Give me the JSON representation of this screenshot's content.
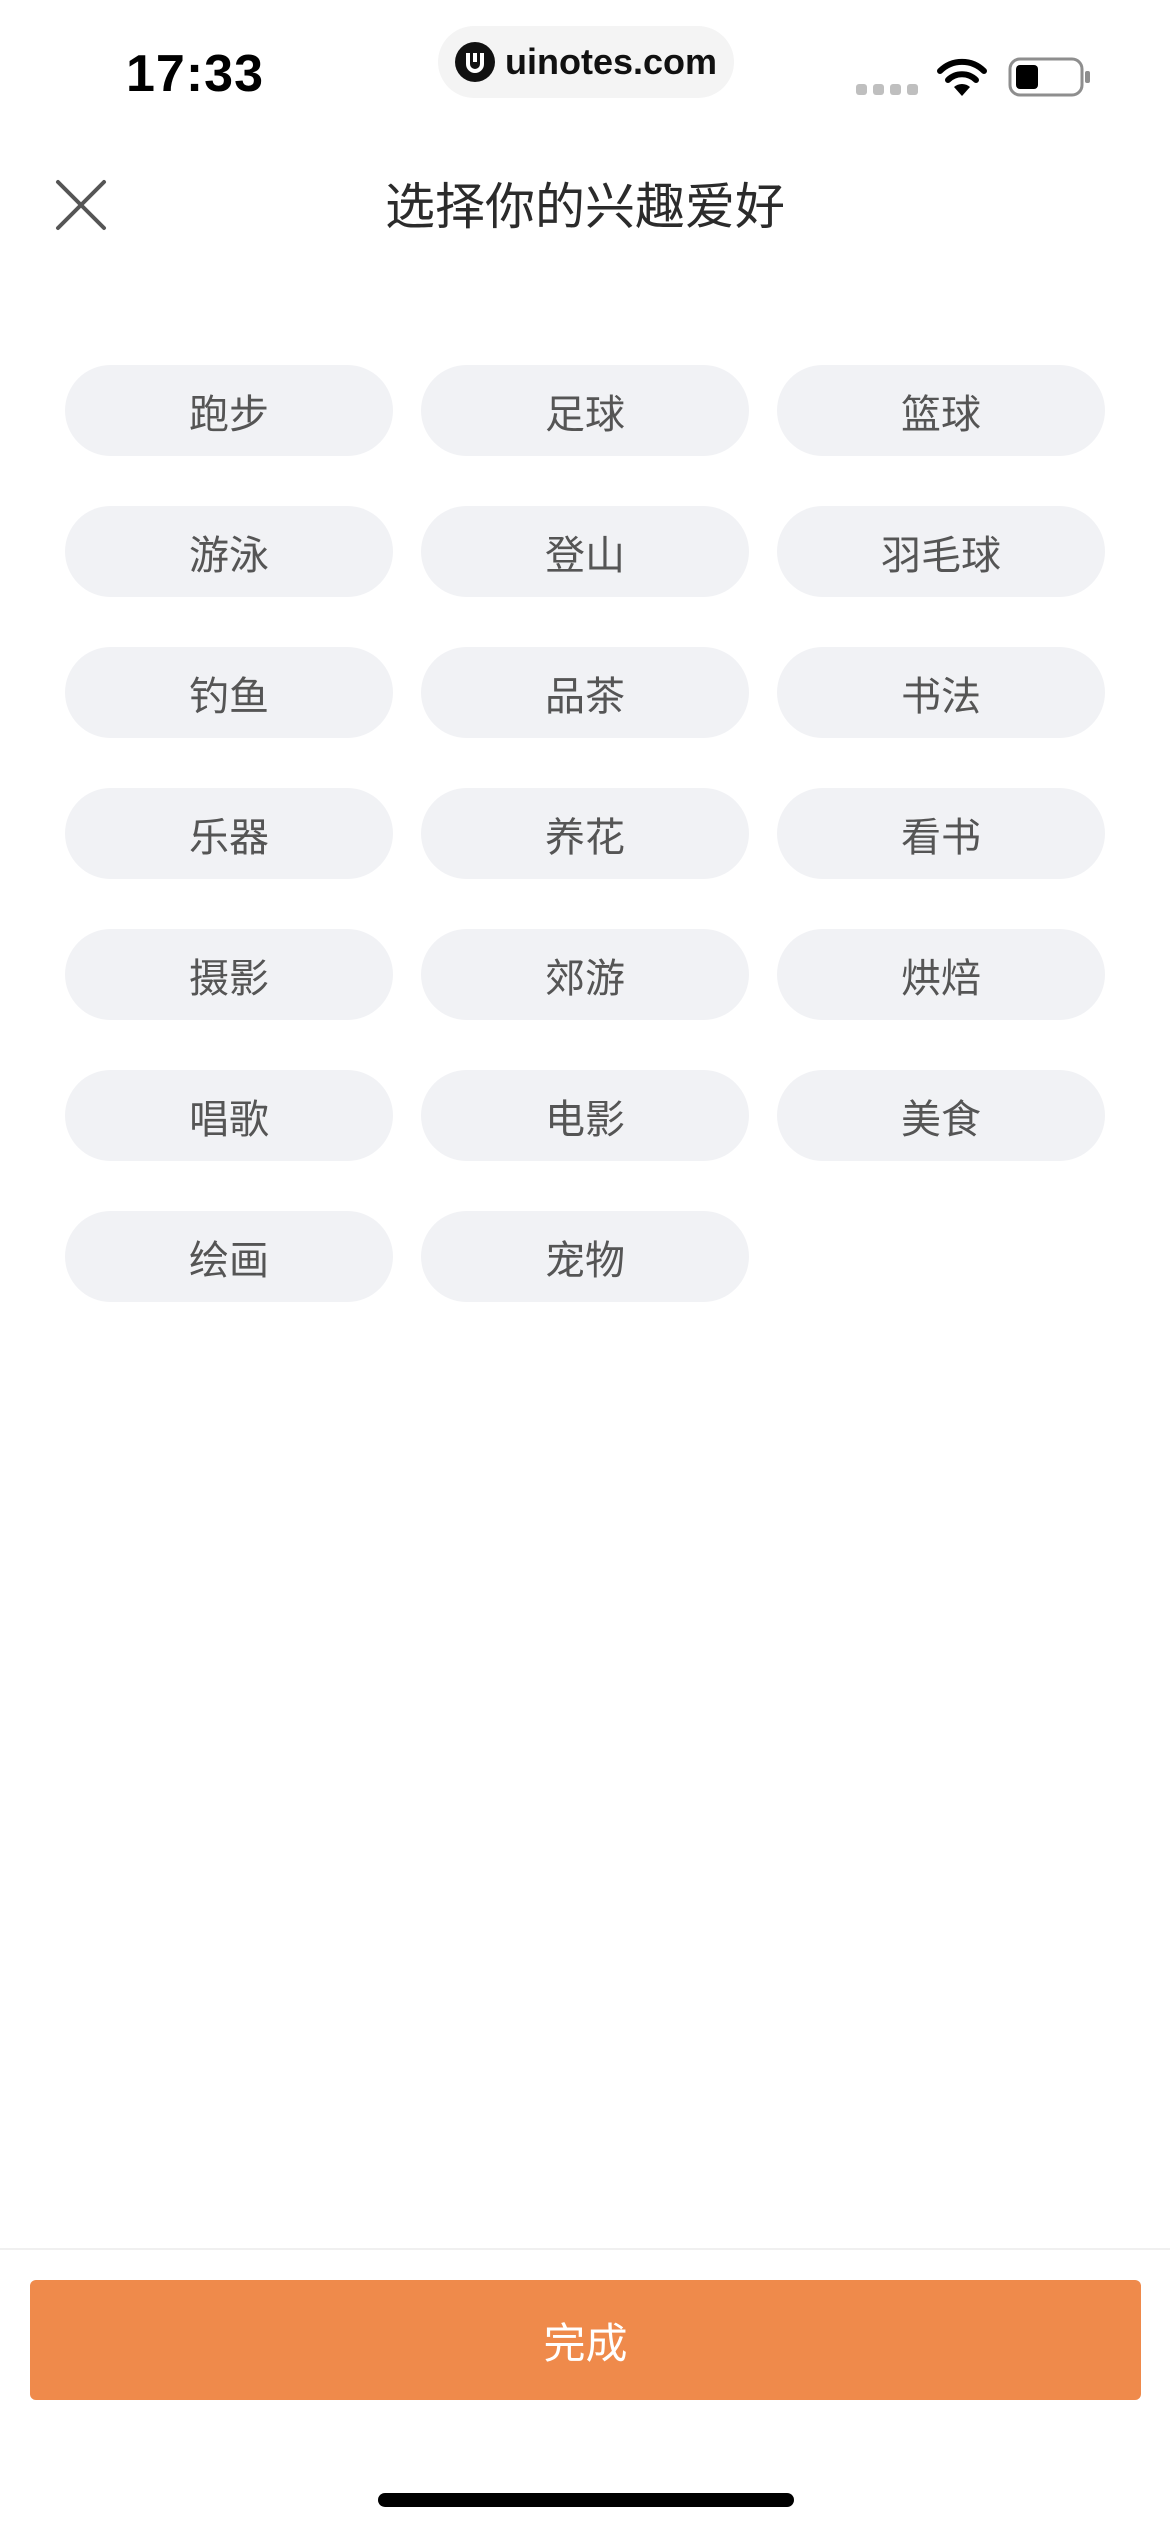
{
  "status_bar": {
    "time": "17:33",
    "watermark": "uinotes.com"
  },
  "header": {
    "title": "选择你的兴趣爱好"
  },
  "tags": [
    "跑步",
    "足球",
    "篮球",
    "游泳",
    "登山",
    "羽毛球",
    "钓鱼",
    "品茶",
    "书法",
    "乐器",
    "养花",
    "看书",
    "摄影",
    "郊游",
    "烘焙",
    "唱歌",
    "电影",
    "美食",
    "绘画",
    "宠物"
  ],
  "footer": {
    "done_label": "完成"
  },
  "colors": {
    "accent": "#ef8a4b",
    "tag_background": "#f1f2f5",
    "tag_text": "#555555"
  }
}
